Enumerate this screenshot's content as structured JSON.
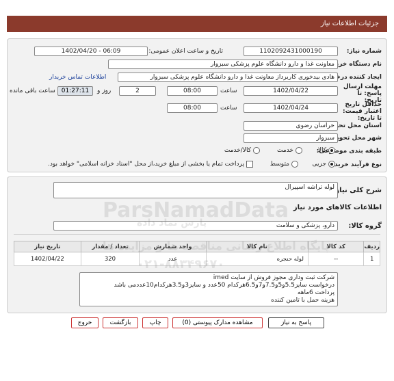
{
  "header": {
    "title": "جزئیات اطلاعات نیاز"
  },
  "form": {
    "need_number_label": "شماره نیاز:",
    "need_number": "1102092431000190",
    "announce_label": "تاریخ و ساعت اعلان عمومی:",
    "announce_value": "1402/04/20 - 06:09",
    "buyer_org_label": "نام دستگاه خریدار:",
    "buyer_org": "معاونت غذا و دارو   دانشگاه علوم پزشکی سبزوار",
    "creator_label": "ایجاد کننده درخواست:",
    "creator": "هادی بیدخوری کاربرداز معاونت غذا و دارو   دانشگاه علوم پزشکی سبزوار",
    "contact_link": "اطلاعات تماس خریدار",
    "deadline_label": "مهلت ارسال پاسخ: تا تاریخ:",
    "deadline_date": "1402/04/22",
    "time_label": "ساعت",
    "deadline_time": "08:00",
    "days_value": "2",
    "days_label": "روز و",
    "timer": "01:27:11",
    "remaining_label": "ساعت باقی مانده",
    "validity_label": "حداقل تاریخ اعتبار قیمت: تا تاریخ:",
    "validity_date": "1402/04/24",
    "validity_time": "08:00",
    "province_label": "استان محل تحویل:",
    "province": "خراسان رضوی",
    "city_label": "شهر محل تحویل:",
    "city": "سبزوار",
    "category_label": "طبقه بندی موضوعی:",
    "cat_goods": "کالا",
    "cat_service": "خدمت",
    "cat_both": "کالا/خدمت",
    "process_label": "نوع فرآیند خرید :",
    "proc_partial": "جزیی",
    "proc_medium": "متوسط",
    "payment_note": "پرداخت تمام یا بخشی از مبلغ خرید،از محل \"اسناد خزانه اسلامی\" خواهد بود."
  },
  "description": {
    "label": "شرح کلی نیاز:",
    "value": "لوله تراشه اسپیرال"
  },
  "goods": {
    "section_title": "اطلاعات کالاهای مورد نیاز",
    "group_label": "گروه کالا:",
    "group_value": "دارو، پزشکی و سلامت",
    "columns": [
      "ردیف",
      "کد کالا",
      "نام کالا",
      "واحد شمارش",
      "تعداد / مقدار",
      "تاریخ نیاز"
    ],
    "rows": [
      {
        "row": "1",
        "code": "--",
        "name": "لوله حنجره",
        "unit": "عدد",
        "qty": "320",
        "date": "1402/04/22"
      }
    ]
  },
  "notes": {
    "lines": [
      "شرکت ثبت وداری مجوز فروش از سایت imed",
      "درخواست سایز5.5و5و7.5و7و6.5هرکدام 50عدد و سایز3و3.5هرکدام10عددمی باشد",
      "پرداخت 6ماهه",
      "هزینه حمل با تامین کننده"
    ]
  },
  "buttons": {
    "reply": "پاسخ به نیاز",
    "attachments": "مشاهده مدارک پیوستی (0)",
    "print": "چاپ",
    "back": "بازگشت",
    "exit": "خروج"
  },
  "watermark": {
    "brand": "ParsNamadData",
    "brand_fa": "پارس نماد داده",
    "line": "پایگاه اطلاع رسانی مناقصه ها و مزایده ها",
    "phone": "۰۲۱-۸۸۳۴۹۶۷۰"
  },
  "colors": {
    "titlebar": "#8b3a2c",
    "link": "#1a3f9a",
    "button_border": "#cc3333"
  }
}
